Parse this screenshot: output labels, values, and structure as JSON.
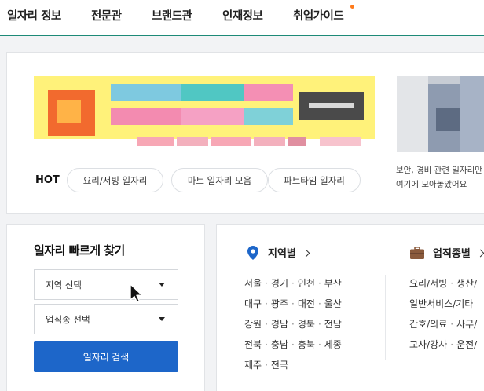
{
  "nav": {
    "items": [
      "일자리 정보",
      "전문관",
      "브랜드관",
      "인재정보",
      "취업가이드"
    ]
  },
  "hot": {
    "label": "HOT",
    "chips": [
      "요리/서빙 일자리",
      "마트 일자리 모음",
      "파트타임 일자리"
    ]
  },
  "side_banner": {
    "line1": "보안, 경비 관련 일자리만",
    "line2": "여기에 모아놓았어요"
  },
  "quick_search": {
    "title": "일자리 빠르게 찾기",
    "region_select": "지역 선택",
    "industry_select": "업직종 선택",
    "search_button": "일자리 검색"
  },
  "region": {
    "heading": "지역별",
    "rows": [
      [
        "서울",
        "경기",
        "인천",
        "부산"
      ],
      [
        "대구",
        "광주",
        "대전",
        "울산"
      ],
      [
        "강원",
        "경남",
        "경북",
        "전남"
      ],
      [
        "전북",
        "충남",
        "충북",
        "세종"
      ],
      [
        "제주",
        "전국"
      ]
    ]
  },
  "industry": {
    "heading": "업직종별",
    "rows": [
      [
        "요리/서빙",
        "생산/"
      ],
      [
        "일반서비스/기타"
      ],
      [
        "간호/의료",
        "사무/"
      ],
      [
        "교사/강사",
        "운전/"
      ]
    ]
  },
  "colors": {
    "accent_green": "#1d8a77",
    "button_blue": "#1d66c9",
    "notify_orange": "#ff7a1a",
    "pin_blue": "#1d66c9",
    "briefcase_brown": "#8a5a3c"
  }
}
